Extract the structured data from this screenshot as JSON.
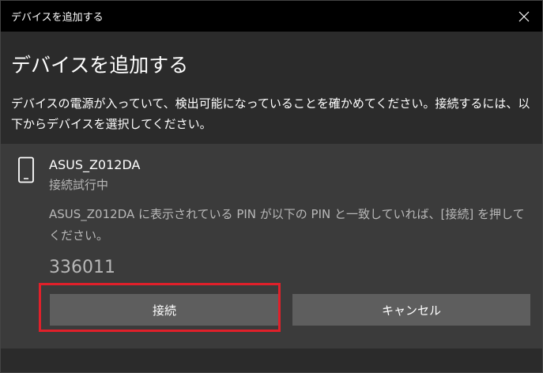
{
  "window": {
    "title": "デバイスを追加する"
  },
  "dialog": {
    "heading": "デバイスを追加する",
    "instructions": "デバイスの電源が入っていて、検出可能になっていることを確かめてください。接続するには、以下からデバイスを選択してください。"
  },
  "device": {
    "icon": "phone-icon",
    "name": "ASUS_Z012DA",
    "status": "接続試行中",
    "pin_instruction": "ASUS_Z012DA に表示されている PIN が以下の PIN と一致していれば、[接続] を押してください。",
    "pin": "336011"
  },
  "buttons": {
    "connect_label": "接続",
    "cancel_label": "キャンセル"
  },
  "colors": {
    "titlebar": "#000000",
    "background": "#2b2b2b",
    "panel": "#3b3b3b",
    "button": "#5e5e5e",
    "highlight": "#e0202a"
  }
}
